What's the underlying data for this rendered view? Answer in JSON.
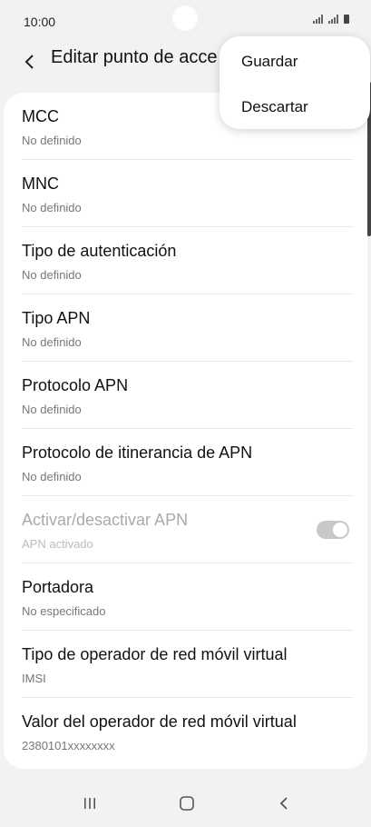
{
  "status_bar": {
    "time": "10:00",
    "icons": [
      "signal-icon",
      "signal-icon",
      "battery-icon"
    ]
  },
  "header": {
    "title": "Editar punto de acce",
    "back_icon": "chevron-left-icon"
  },
  "menu": {
    "items": [
      {
        "label": "Guardar"
      },
      {
        "label": "Descartar"
      }
    ]
  },
  "settings": [
    {
      "title": "MCC",
      "subtitle": "No definido"
    },
    {
      "title": "MNC",
      "subtitle": "No definido"
    },
    {
      "title": "Tipo de autenticación",
      "subtitle": "No definido"
    },
    {
      "title": "Tipo APN",
      "subtitle": "No definido"
    },
    {
      "title": "Protocolo APN",
      "subtitle": "No definido"
    },
    {
      "title": "Protocolo de itinerancia de APN",
      "subtitle": "No definido"
    },
    {
      "title": "Activar/desactivar APN",
      "subtitle": "APN activado",
      "toggle": true,
      "enabled": false
    },
    {
      "title": "Portadora",
      "subtitle": "No especificado"
    },
    {
      "title": "Tipo de operador de red móvil virtual",
      "subtitle": "IMSI"
    },
    {
      "title": "Valor del operador de red móvil virtual",
      "subtitle": "2380101xxxxxxxx"
    }
  ],
  "nav": {
    "icons": [
      "recent-apps-icon",
      "home-icon",
      "back-icon"
    ]
  }
}
